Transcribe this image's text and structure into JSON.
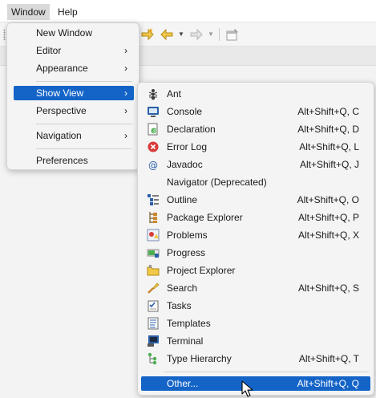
{
  "menubar": {
    "items": [
      {
        "label": "Window"
      },
      {
        "label": "Help"
      }
    ]
  },
  "toolbar": {
    "icons": [
      "next-annotation-icon",
      "back-icon",
      "forward-icon",
      "pin-editor-icon"
    ]
  },
  "window_menu": {
    "items": [
      {
        "label": "New Window",
        "has_submenu": false
      },
      {
        "label": "Editor",
        "has_submenu": true
      },
      {
        "label": "Appearance",
        "has_submenu": true
      },
      {
        "label": "Show View",
        "has_submenu": true,
        "selected": true
      },
      {
        "label": "Perspective",
        "has_submenu": true
      },
      {
        "label": "Navigation",
        "has_submenu": true
      },
      {
        "label": "Preferences",
        "has_submenu": false
      }
    ],
    "arrow_glyph": "›"
  },
  "show_view_menu": {
    "items": [
      {
        "label": "Ant",
        "accel": "",
        "icon": "ant-icon"
      },
      {
        "label": "Console",
        "accel": "Alt+Shift+Q, C",
        "icon": "console-icon"
      },
      {
        "label": "Declaration",
        "accel": "Alt+Shift+Q, D",
        "icon": "declaration-icon"
      },
      {
        "label": "Error Log",
        "accel": "Alt+Shift+Q, L",
        "icon": "error-log-icon"
      },
      {
        "label": "Javadoc",
        "accel": "Alt+Shift+Q, J",
        "icon": "javadoc-icon"
      },
      {
        "label": "Navigator (Deprecated)",
        "accel": "",
        "icon": "navigator-icon"
      },
      {
        "label": "Outline",
        "accel": "Alt+Shift+Q, O",
        "icon": "outline-icon"
      },
      {
        "label": "Package Explorer",
        "accel": "Alt+Shift+Q, P",
        "icon": "package-explorer-icon"
      },
      {
        "label": "Problems",
        "accel": "Alt+Shift+Q, X",
        "icon": "problems-icon"
      },
      {
        "label": "Progress",
        "accel": "",
        "icon": "progress-icon"
      },
      {
        "label": "Project Explorer",
        "accel": "",
        "icon": "project-explorer-icon"
      },
      {
        "label": "Search",
        "accel": "Alt+Shift+Q, S",
        "icon": "search-icon"
      },
      {
        "label": "Tasks",
        "accel": "",
        "icon": "tasks-icon"
      },
      {
        "label": "Templates",
        "accel": "",
        "icon": "templates-icon"
      },
      {
        "label": "Terminal",
        "accel": "",
        "icon": "terminal-icon"
      },
      {
        "label": "Type Hierarchy",
        "accel": "Alt+Shift+Q, T",
        "icon": "type-hierarchy-icon"
      },
      {
        "label": "Other...",
        "accel": "Alt+Shift+Q, Q",
        "icon": "",
        "selected": true
      }
    ]
  },
  "colors": {
    "selection": "#1464c8",
    "menu_background": "#f4f4f4"
  }
}
